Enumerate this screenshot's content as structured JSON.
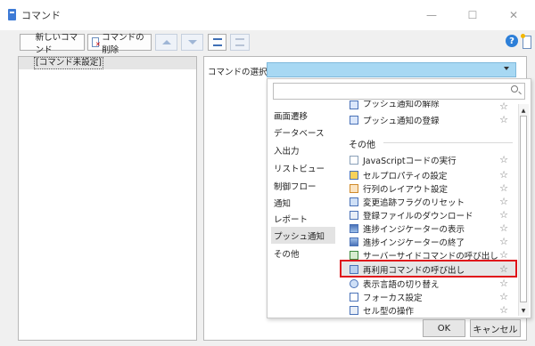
{
  "window": {
    "title": "コマンド",
    "controls": {
      "minimize": "—",
      "maximize": "☐",
      "close": "✕"
    }
  },
  "toolbar": {
    "new_command": "新しいコマンド",
    "delete_command": "コマンドの削除",
    "help": "?"
  },
  "left_panel": {
    "items": [
      "[コマンド未設定]"
    ]
  },
  "right_panel": {
    "select_label": "コマンドの選択：",
    "dropdown": {
      "search_placeholder": "",
      "categories": [
        "画面遷移",
        "データベース",
        "入出力",
        "リストビュー",
        "制御フロー",
        "通知",
        "レポート",
        "プッシュ通知",
        "その他"
      ],
      "active_category": "プッシュ通知",
      "items_top": [
        "プッシュ通知の解除",
        "プッシュ通知の登録"
      ],
      "section": "その他",
      "items": [
        "JavaScriptコードの実行",
        "セルプロパティの設定",
        "行列のレイアウト設定",
        "変更追跡フラグのリセット",
        "登録ファイルのダウンロード",
        "進捗インジケーターの表示",
        "進捗インジケーターの終了",
        "サーバーサイドコマンドの呼び出し",
        "再利用コマンドの呼び出し",
        "表示言語の切り替え",
        "フォーカス設定",
        "セル型の操作"
      ],
      "highlighted_item": "再利用コマンドの呼び出し",
      "favorite_glyph": "☆"
    }
  },
  "buttons": {
    "ok": "OK",
    "cancel": "キャンセル"
  },
  "colors": {
    "accent": "#2d7fd8",
    "selection": "#a7d8f3",
    "highlight_border": "#e0141b"
  }
}
